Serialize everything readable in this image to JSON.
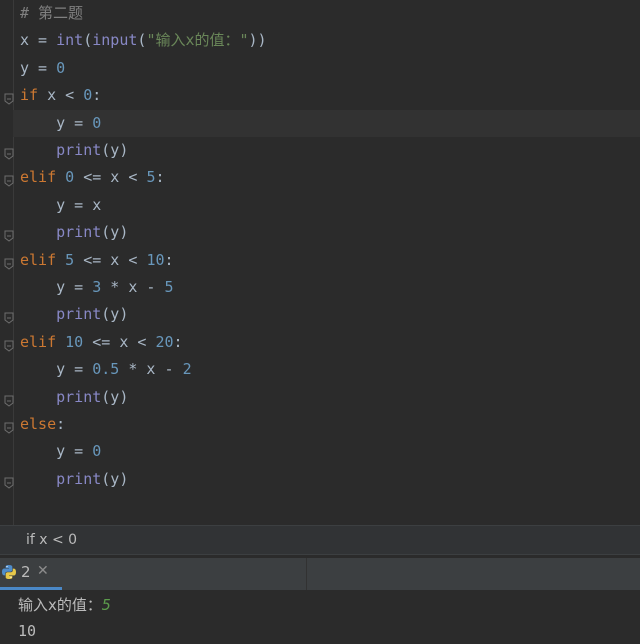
{
  "editor": {
    "lines": [
      {
        "parts": [
          {
            "t": "# 第二题",
            "c": "cm"
          }
        ]
      },
      {
        "parts": [
          {
            "t": "x = ",
            "c": ""
          },
          {
            "t": "int",
            "c": "bi"
          },
          {
            "t": "(",
            "c": ""
          },
          {
            "t": "input",
            "c": "bi"
          },
          {
            "t": "(",
            "c": ""
          },
          {
            "t": "\"输入x的值：\"",
            "c": "str"
          },
          {
            "t": "))",
            "c": ""
          }
        ]
      },
      {
        "parts": [
          {
            "t": "y = ",
            "c": ""
          },
          {
            "t": "0",
            "c": "num"
          }
        ]
      },
      {
        "parts": [
          {
            "t": "if",
            "c": "kw"
          },
          {
            "t": " x < ",
            "c": ""
          },
          {
            "t": "0",
            "c": "num"
          },
          {
            "t": ":",
            "c": ""
          }
        ]
      },
      {
        "parts": [
          {
            "t": "    y = ",
            "c": ""
          },
          {
            "t": "0",
            "c": "num"
          }
        ],
        "caret": true
      },
      {
        "parts": [
          {
            "t": "    ",
            "c": ""
          },
          {
            "t": "print",
            "c": "bi"
          },
          {
            "t": "(y)",
            "c": ""
          }
        ]
      },
      {
        "parts": [
          {
            "t": "elif",
            "c": "kw"
          },
          {
            "t": " ",
            "c": ""
          },
          {
            "t": "0",
            "c": "num"
          },
          {
            "t": " <= x < ",
            "c": ""
          },
          {
            "t": "5",
            "c": "num"
          },
          {
            "t": ":",
            "c": ""
          }
        ]
      },
      {
        "parts": [
          {
            "t": "    y = x",
            "c": ""
          }
        ]
      },
      {
        "parts": [
          {
            "t": "    ",
            "c": ""
          },
          {
            "t": "print",
            "c": "bi"
          },
          {
            "t": "(y)",
            "c": ""
          }
        ]
      },
      {
        "parts": [
          {
            "t": "elif",
            "c": "kw"
          },
          {
            "t": " ",
            "c": ""
          },
          {
            "t": "5",
            "c": "num"
          },
          {
            "t": " <= x < ",
            "c": ""
          },
          {
            "t": "10",
            "c": "num"
          },
          {
            "t": ":",
            "c": ""
          }
        ]
      },
      {
        "parts": [
          {
            "t": "    y = ",
            "c": ""
          },
          {
            "t": "3",
            "c": "num"
          },
          {
            "t": " * x - ",
            "c": ""
          },
          {
            "t": "5",
            "c": "num"
          }
        ]
      },
      {
        "parts": [
          {
            "t": "    ",
            "c": ""
          },
          {
            "t": "print",
            "c": "bi"
          },
          {
            "t": "(y)",
            "c": ""
          }
        ]
      },
      {
        "parts": [
          {
            "t": "elif",
            "c": "kw"
          },
          {
            "t": " ",
            "c": ""
          },
          {
            "t": "10",
            "c": "num"
          },
          {
            "t": " <= x < ",
            "c": ""
          },
          {
            "t": "20",
            "c": "num"
          },
          {
            "t": ":",
            "c": ""
          }
        ]
      },
      {
        "parts": [
          {
            "t": "    y = ",
            "c": ""
          },
          {
            "t": "0.5",
            "c": "num"
          },
          {
            "t": " * x - ",
            "c": ""
          },
          {
            "t": "2",
            "c": "num"
          }
        ]
      },
      {
        "parts": [
          {
            "t": "    ",
            "c": ""
          },
          {
            "t": "print",
            "c": "bi"
          },
          {
            "t": "(y)",
            "c": ""
          }
        ]
      },
      {
        "parts": [
          {
            "t": "else",
            "c": "kw"
          },
          {
            "t": ":",
            "c": ""
          }
        ]
      },
      {
        "parts": [
          {
            "t": "    y = ",
            "c": ""
          },
          {
            "t": "0",
            "c": "num"
          }
        ]
      },
      {
        "parts": [
          {
            "t": "    ",
            "c": ""
          },
          {
            "t": "print",
            "c": "bi"
          },
          {
            "t": "(y)",
            "c": ""
          }
        ]
      }
    ],
    "fold_lines": [
      3,
      5,
      6,
      8,
      9,
      11,
      12,
      14,
      15,
      17
    ]
  },
  "breadcrumb": {
    "text": "if x < 0"
  },
  "run_panel": {
    "tab_label": "2",
    "tab_close": "✕",
    "tab_icon": "python-icon"
  },
  "console": {
    "prompt": "输入x的值：",
    "input_value": "5",
    "output": "10"
  },
  "colors": {
    "background": "#2b2b2b",
    "keyword": "#cc7832",
    "number": "#6897bb",
    "string": "#6a8759",
    "builtin": "#8888c6",
    "comment": "#808080",
    "input_green": "#5b9b4b"
  }
}
